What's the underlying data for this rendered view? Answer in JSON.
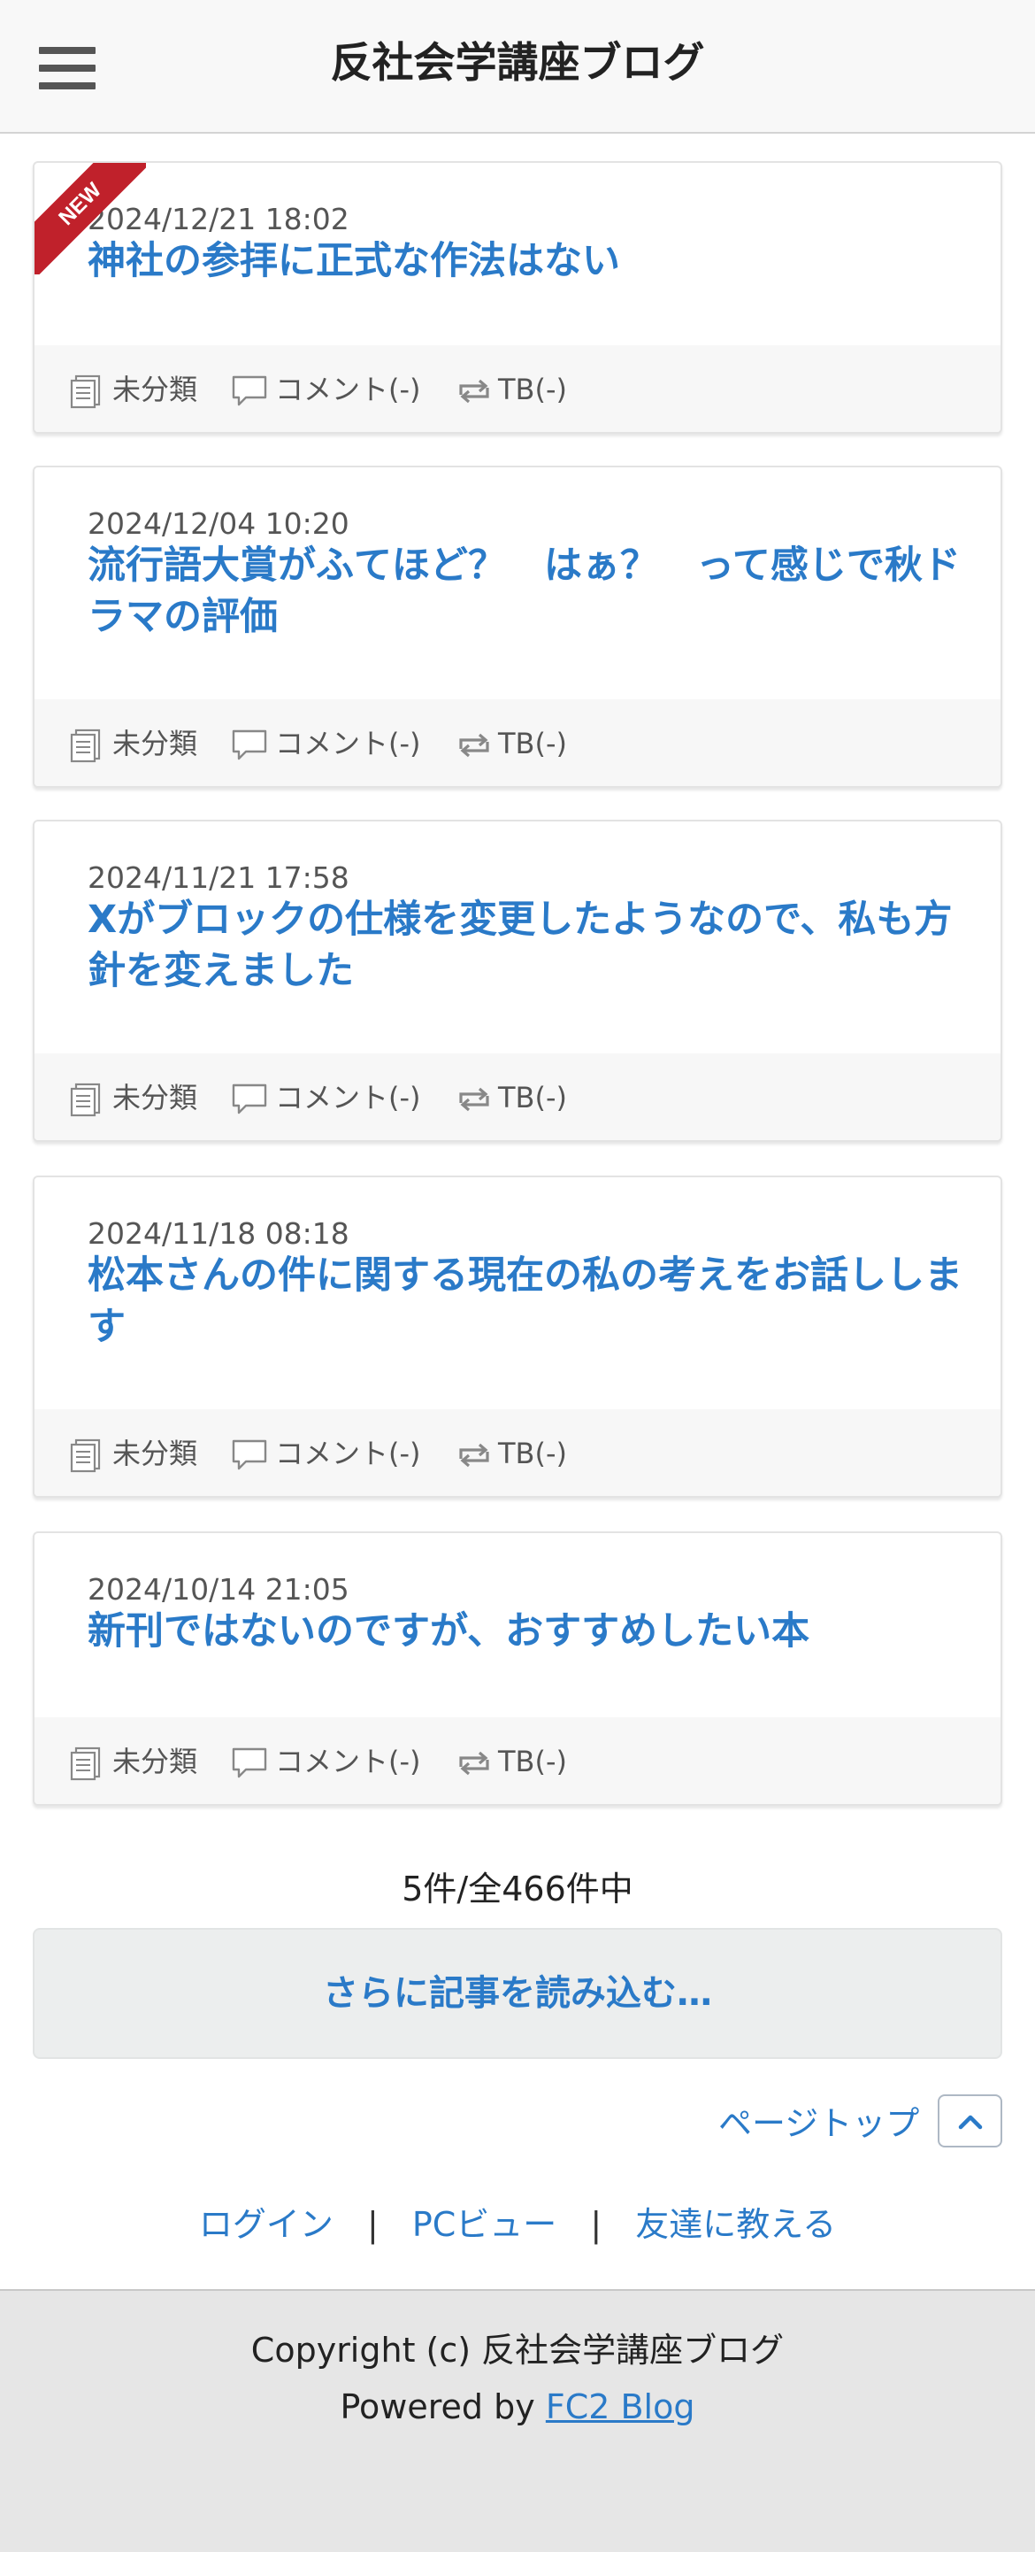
{
  "header": {
    "site_title": "反社会学講座ブログ",
    "menu_icon": "hamburger-menu-icon"
  },
  "posts": [
    {
      "date": "2024/12/21 18:02",
      "title": "神社の参拝に正式な作法はない",
      "badge": "NEW",
      "category": "未分類",
      "comments": "コメント(-)",
      "trackbacks": "TB(-)"
    },
    {
      "date": "2024/12/04 10:20",
      "title": "流行語大賞がふてほど？　はぁ？　って感じで秋ドラマの評価",
      "category": "未分類",
      "comments": "コメント(-)",
      "trackbacks": "TB(-)"
    },
    {
      "date": "2024/11/21 17:58",
      "title": "Xがブロックの仕様を変更したようなので、私も方針を変えました",
      "category": "未分類",
      "comments": "コメント(-)",
      "trackbacks": "TB(-)"
    },
    {
      "date": "2024/11/18 08:18",
      "title": "松本さんの件に関する現在の私の考えをお話しします",
      "category": "未分類",
      "comments": "コメント(-)",
      "trackbacks": "TB(-)"
    },
    {
      "date": "2024/10/14 21:05",
      "title": "新刊ではないのですが、おすすめしたい本",
      "category": "未分類",
      "comments": "コメント(-)",
      "trackbacks": "TB(-)"
    }
  ],
  "pagination": {
    "count_text": "5件/全466件中",
    "load_more_label": "さらに記事を読み込む…"
  },
  "pagetop": {
    "label": "ページトップ",
    "icon": "chevron-up-icon"
  },
  "footer_links": {
    "login": "ログイン",
    "separator": "|",
    "pc_view": "PCビュー",
    "tell_friend": "友達に教える"
  },
  "footer": {
    "copyright": "Copyright (c) 反社会学講座ブログ",
    "powered_prefix": "Powered by",
    "powered_link": "FC2 Blog"
  },
  "colors": {
    "accent": "#2a7ac8",
    "new_badge": "#c0212b",
    "header_bg": "#f8f8f8",
    "footer_bg": "#e6e6e6"
  }
}
